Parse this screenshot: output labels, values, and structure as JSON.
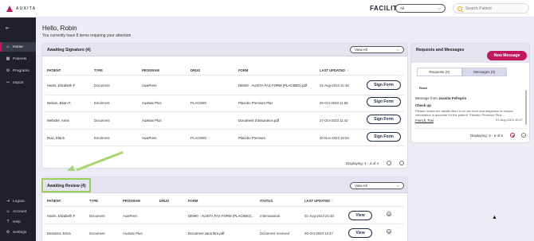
{
  "brand": {
    "logo_text": "AUXITA"
  },
  "header": {
    "facility_label": "FACILITY",
    "facility_value": "All",
    "search_placeholder": "Search Patient"
  },
  "sidebar": {
    "items": [
      {
        "label": "Home",
        "icon": "home-icon"
      },
      {
        "label": "Patients",
        "icon": "patients-icon"
      },
      {
        "label": "Programs",
        "icon": "programs-icon"
      },
      {
        "label": "Import",
        "icon": "import-icon"
      }
    ],
    "bottom": [
      {
        "label": "Logout",
        "icon": "logout-icon"
      },
      {
        "label": "Account",
        "icon": "account-icon"
      },
      {
        "label": "Help",
        "icon": "help-icon"
      },
      {
        "label": "Settings",
        "icon": "settings-icon"
      }
    ]
  },
  "main": {
    "greeting": "Hello, Robin",
    "subtitle": "You currently have 8 items requiring your attention"
  },
  "signature": {
    "title": "Awaiting Signature (4)",
    "view": "View All",
    "columns": [
      "PATIENT",
      "TYPE",
      "PROGRAM",
      "DRUG",
      "FORM",
      "LAST UPDATED"
    ],
    "rows": [
      {
        "patient": "Harris, Elizabeth F",
        "type": "Document",
        "program": "AuxiPrem",
        "drug": "",
        "form": "DEMO - AUXITA FAX FORM (PLACEBO).pdf",
        "updated": "01-Aug-2023 21:46",
        "action": "Sign Form"
      },
      {
        "patient": "Nelson, Brian F.",
        "type": "Enrolment",
        "program": "AuxNav Plus",
        "drug": "PLACEBO",
        "form": "Placebo Premium Plus",
        "updated": "25-Oct-2023 11:58",
        "action": "Sign Form"
      },
      {
        "patient": "Webster, Anne",
        "type": "Document",
        "program": "AuxNav Plus",
        "drug": "",
        "form": "Document d'assurance.pdf",
        "updated": "27-Oct-2023 11:42",
        "action": "Sign Form"
      },
      {
        "patient": "Ruiz, Ella E.",
        "type": "Enrolment",
        "program": "AuxiPrem",
        "drug": "PLACEBO",
        "form": "Placebo Premium",
        "updated": "20-Nov-2023 15:04",
        "action": "Sign Form"
      }
    ],
    "displaying": "Displaying: 1 - 4 of 4"
  },
  "review": {
    "title": "Awaiting Review (4)",
    "view": "View All",
    "columns": [
      "PATIENT",
      "TYPE",
      "PROGRAM",
      "DRUG",
      "FORM",
      "STATUS",
      "LAST UPDATED"
    ],
    "rows": [
      {
        "patient": "Harris, Elizabeth F",
        "type": "Document",
        "program": "AuxiPrem",
        "drug": "",
        "form": "DEMO - AUXITA FAX FORM (PLACEBO)...",
        "status": "Informational",
        "updated": "01-Aug-2023 21:48",
        "action": "View"
      },
      {
        "patient": "Demarco, Erica",
        "type": "Document",
        "program": "AuxNav Plus",
        "drug": "",
        "form": "Document sans titre.pdf",
        "status": "Document received",
        "updated": "26-Oct-2023 12:27",
        "action": "View"
      }
    ]
  },
  "requests": {
    "title": "Requests and Messages",
    "new_button": "New Message",
    "tabs": [
      "Requests (0)",
      "Messages (0)"
    ],
    "read_label": "Read",
    "message": {
      "from_prefix": "Message from",
      "from_name": "Juanita Pellegrin",
      "subject": "Check up",
      "body": "Please review the details filled in on the form and diagnosis to ensure information is accurate for the patient. Placebo Premium Plus...",
      "date": "01-Aug-2023 15:27",
      "author": "French, Toni"
    },
    "displaying": "Displaying: 6 - 6 of 6"
  },
  "colors": {
    "accent": "#c2185b",
    "sidebar": "#1f2028",
    "highlight": "#9ccf5a"
  }
}
